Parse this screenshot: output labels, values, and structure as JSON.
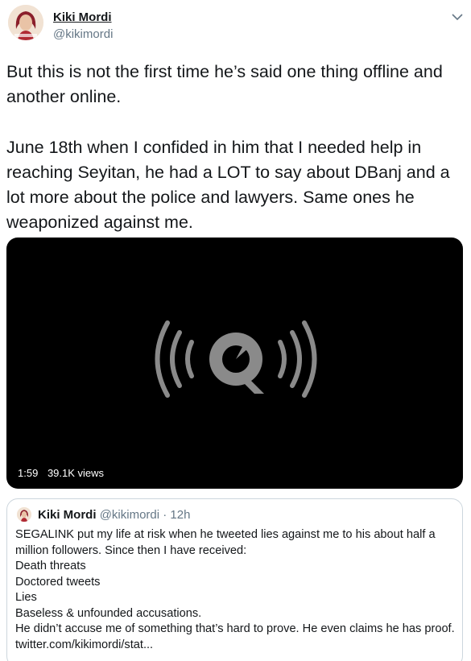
{
  "author": {
    "display_name": "Kiki Mordi",
    "handle": "@kikimordi",
    "avatar_icon": "avatar-portrait"
  },
  "menu": {
    "icon": "chevron-down-icon"
  },
  "tweet": {
    "text": "But this is not the first time he’s said one thing offline and another online.\n\nJune 18th when I confided in him that I needed help in reaching Seyitan, he had a LOT to say about DBanj and a lot more about the police and lawyers. Same ones he weaponized against me."
  },
  "video": {
    "duration": "1:59",
    "views": "39.1K views",
    "icon": "quicktime-logo-icon"
  },
  "quoted_tweet": {
    "display_name": "Kiki Mordi",
    "handle": "@kikimordi",
    "time": "· 12h",
    "text": "SEGALINK put my life at risk when he tweeted lies against me to his about half a million followers. Since then I have received:\nDeath threats\nDoctored tweets\nLies\nBaseless & unfounded accusations.\nHe didn’t accuse me of something that’s hard to prove. He even claims he has proof. twitter.com/kikimordi/stat..."
  },
  "colors": {
    "text": "#14171a",
    "secondary": "#657786",
    "border": "#ccd6dd",
    "video_bg": "#000000"
  }
}
